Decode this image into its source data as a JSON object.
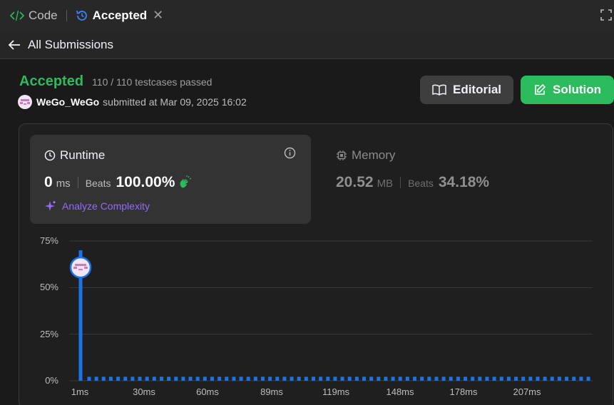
{
  "tabs": {
    "code_label": "Code",
    "accepted_label": "Accepted",
    "close_glyph": "✕"
  },
  "nav": {
    "back_label": "All Submissions"
  },
  "submission": {
    "status": "Accepted",
    "testcases": "110 / 110 testcases passed",
    "username": "WeGo_WeGo",
    "submitted_text": "submitted at Mar 09, 2025 16:02"
  },
  "buttons": {
    "editorial_label": "Editorial",
    "solution_label": "Solution"
  },
  "runtime": {
    "title": "Runtime",
    "value": "0",
    "unit": "ms",
    "beats_label": "Beats",
    "beats_value": "100.00%",
    "analyze_label": "Analyze Complexity"
  },
  "memory": {
    "title": "Memory",
    "value": "20.52",
    "unit": "MB",
    "beats_label": "Beats",
    "beats_value": "34.18%"
  },
  "colors": {
    "accent_green": "#2cbb5d",
    "bar_blue": "#1a73e8",
    "analyze_purple": "#8f6cf5"
  },
  "chart_data": {
    "type": "bar",
    "y_ticks": [
      "75%",
      "50%",
      "25%",
      "0%"
    ],
    "x_ticks": [
      "1ms",
      "30ms",
      "60ms",
      "89ms",
      "119ms",
      "148ms",
      "178ms",
      "207ms"
    ],
    "ylim": [
      0,
      75
    ],
    "highlight_x": "1ms",
    "highlight_value": 70,
    "baseline_value": 1,
    "baseline_bar_count": 70,
    "grid": true
  }
}
